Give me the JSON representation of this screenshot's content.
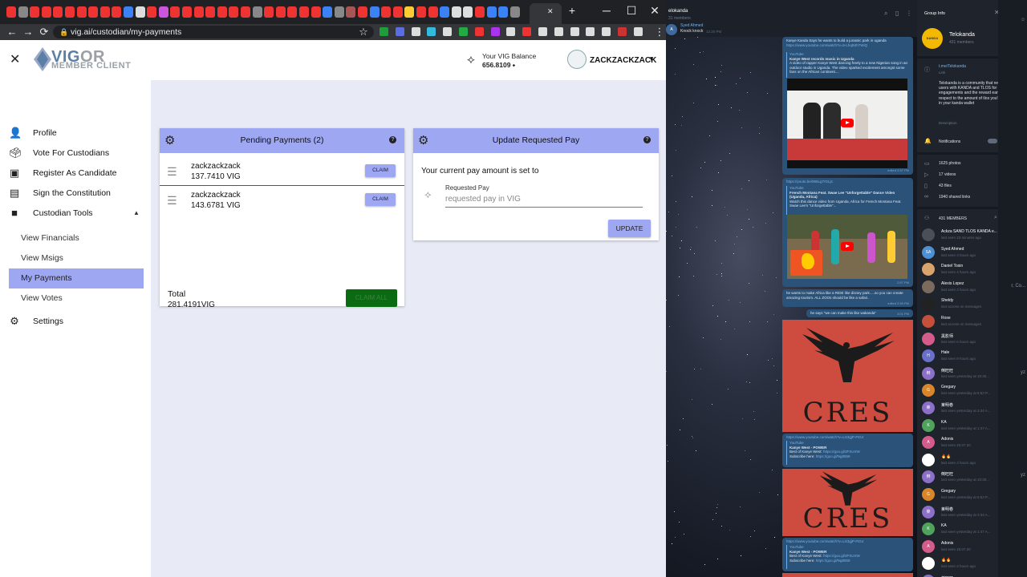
{
  "browser": {
    "url": "vig.ai/custodian/my-payments",
    "window_controls": {
      "minimize": "─",
      "maximize": "☐",
      "close": "✕"
    },
    "tab_close": "✕",
    "new_tab": "+"
  },
  "app": {
    "logo_title_vig": "VIG",
    "logo_title_or": "OR",
    "logo_subtitle": "MEMBER CLIENT",
    "balance_label": "Your VIG Balance",
    "balance_value": "656.8109",
    "username": "ZACKZACKZACK"
  },
  "sidebar": {
    "items": [
      {
        "label": "Profile",
        "icon": "person-icon"
      },
      {
        "label": "Vote For Custodians",
        "icon": "vote-icon"
      },
      {
        "label": "Register As Candidate",
        "icon": "badge-icon"
      },
      {
        "label": "Sign the Constitution",
        "icon": "document-icon"
      },
      {
        "label": "Custodian Tools",
        "icon": "folder-icon"
      }
    ],
    "sub_items": [
      {
        "label": "View Financials"
      },
      {
        "label": "View Msigs"
      },
      {
        "label": "My Payments"
      },
      {
        "label": "View Votes"
      }
    ],
    "settings_label": "Settings"
  },
  "pending": {
    "title": "Pending Payments (2)",
    "rows": [
      {
        "name": "zackzackzack",
        "amount": "137.7410 VIG",
        "button": "CLAIM"
      },
      {
        "name": "zackzackzack",
        "amount": "143.6781 VIG",
        "button": "CLAIM"
      }
    ],
    "total_label": "Total",
    "total_value": "281.4191VIG",
    "claim_all": "CLAIM ALL"
  },
  "update": {
    "title": "Update Requested Pay",
    "current_text": "Your current pay amount is set to",
    "field_label": "Requested Pay",
    "field_placeholder": "requested pay in VIG",
    "button": "UPDATE"
  },
  "telegram": {
    "chat_title": "elokanda",
    "chat_sub": "31 members",
    "pinned_avatar": "A",
    "pinned_name": "Syed Ahmed",
    "pinned_text": "Knock knock",
    "pinned_time": "12:20 PM",
    "messages": [
      {
        "text": "Kanye Kanda Says he wants to build a jurassic park in uganda",
        "link": "https://www.youtube.com/watch?v=5-LhqB4h7WiQ",
        "source": "YouTube",
        "pv_title": "Kanye West records music in Uganda",
        "pv_desc": "A video of rapper Kanye West dancing freely to a new Nigerian song in an outdoor studio in Uganda. The video sparked excitement amongst some fans on the African continent....",
        "meta": "edited 2:57 PM"
      },
      {
        "link": "https://youtu.be/066Lg7rGLjs",
        "source": "YouTube",
        "pv_title": "French Montana Feat. Swae Lee \"Unforgettable\" Dance Video (Uganda, Africa)",
        "pv_desc": "Watch this dance video from Uganda, Africa for French Montana Feat. Swae Lee's \"Unforgettable\"...",
        "meta": "2:57 PM"
      },
      {
        "text": "he wants to make Africa like a RIDE like disney park.....so you can create amazing tourism. ALL ZOOs should be like a safari..",
        "meta": "edited 2:59 PM"
      },
      {
        "text": "he says \"we can make this like wakanda\"",
        "meta": "3:01 PM"
      }
    ],
    "poster_word": "CRES",
    "yt_link": "https://www.youtube.com/watch?v=LS3gjP-FtG4",
    "yt_source": "YouTube",
    "yt_title": "Kanye West - POWER",
    "yt_line1": "Best of Kanye West: ",
    "yt_line1_link": "https://goo.gl/3FXUXW",
    "yt_line2": "Subscribe here: ",
    "yt_line2_link": "https://goo.gl/Ng8559",
    "info_title": "Group Info",
    "group_avatar": "KANDA",
    "group_name": "Telokanda",
    "group_members": "431 members",
    "link": "t.me/Telokanda",
    "link_label": "Link",
    "description": "Telokanda is a community that rewards their users with KANDA and TLOS for engagements and the reward earned with respect to the amount of tlos you're holding in your kanda wallet",
    "description_label": "Description",
    "notifications": "Notifications",
    "stats": [
      "1625 photos",
      "17 videos",
      "43 files",
      "1940 shared links"
    ],
    "members_title": "431 MEMBERS",
    "members": [
      {
        "name": "Ackza SAND TLOS KANDA e...",
        "status": "last seen 23 minutes ago",
        "color": "#4a4f58"
      },
      {
        "name": "Syed Ahmed",
        "status": "last seen 3 hours ago",
        "color": "#4f8fd4",
        "initials": "SA"
      },
      {
        "name": "Daniel Tosin",
        "status": "last seen 4 hours ago",
        "color": "#d8a46b"
      },
      {
        "name": "Alexis Lopez",
        "status": "last seen 2 hours ago",
        "color": "#7b6a5e"
      },
      {
        "name": "Sheldy",
        "status": "last access on messages",
        "color": "#222"
      },
      {
        "name": "Rose",
        "status": "last access on messages",
        "color": "#c44f3a"
      },
      {
        "name": "黑影师",
        "status": "last seen 6 hours ago",
        "color": "#d45c8b"
      },
      {
        "name": "Hale",
        "status": "last seen 9 hours ago",
        "color": "#6a6fc9",
        "initials": "H"
      },
      {
        "name": "倒旺旺",
        "status": "last seen yesterday at 10:30...",
        "color": "#8b6fc9",
        "initials": "倒"
      },
      {
        "name": "Gregary",
        "status": "last seen yesterday at 6:53 P...",
        "color": "#d9862b",
        "initials": "G"
      },
      {
        "name": "莱明卷",
        "status": "last seen yesterday at 3:34 A...",
        "color": "#8b6fc9",
        "initials": "莱"
      },
      {
        "name": "KA",
        "status": "last seen yesterday at 1:47 A...",
        "color": "#4fa35c",
        "initials": "K"
      },
      {
        "name": "Adonis",
        "status": "last seen 23.07.20",
        "color": "#d45c8b",
        "initials": "A"
      },
      {
        "name": "🔥🔥",
        "status": "last seen 2 hours ago",
        "color": "#ffffff"
      },
      {
        "name": "倒旺旺",
        "status": "last seen yesterday at 10:30...",
        "color": "#8b6fc9",
        "initials": "倒"
      },
      {
        "name": "Gregary",
        "status": "last seen yesterday at 6:53 P...",
        "color": "#d9862b",
        "initials": "G"
      },
      {
        "name": "莱明卷",
        "status": "last seen yesterday at 3:34 A...",
        "color": "#8b6fc9",
        "initials": "莱"
      },
      {
        "name": "KA",
        "status": "last seen yesterday at 1:47 A...",
        "color": "#4fa35c",
        "initials": "K"
      },
      {
        "name": "Adonis",
        "status": "last seen 23.07.20",
        "color": "#d45c8b",
        "initials": "A"
      },
      {
        "name": "🔥🔥",
        "status": "last seen 2 hours ago",
        "color": "#ffffff"
      },
      {
        "name": "倒旺旺",
        "status": "",
        "color": "#8b6fc9",
        "initials": "倒"
      }
    ],
    "edge_texts": [
      "r, Co...",
      "yz",
      "yz"
    ]
  },
  "colors": {
    "accent": "#9ea7f2",
    "content_bg": "#e8eaf6",
    "claim_all_bg": "#0b6b12"
  }
}
